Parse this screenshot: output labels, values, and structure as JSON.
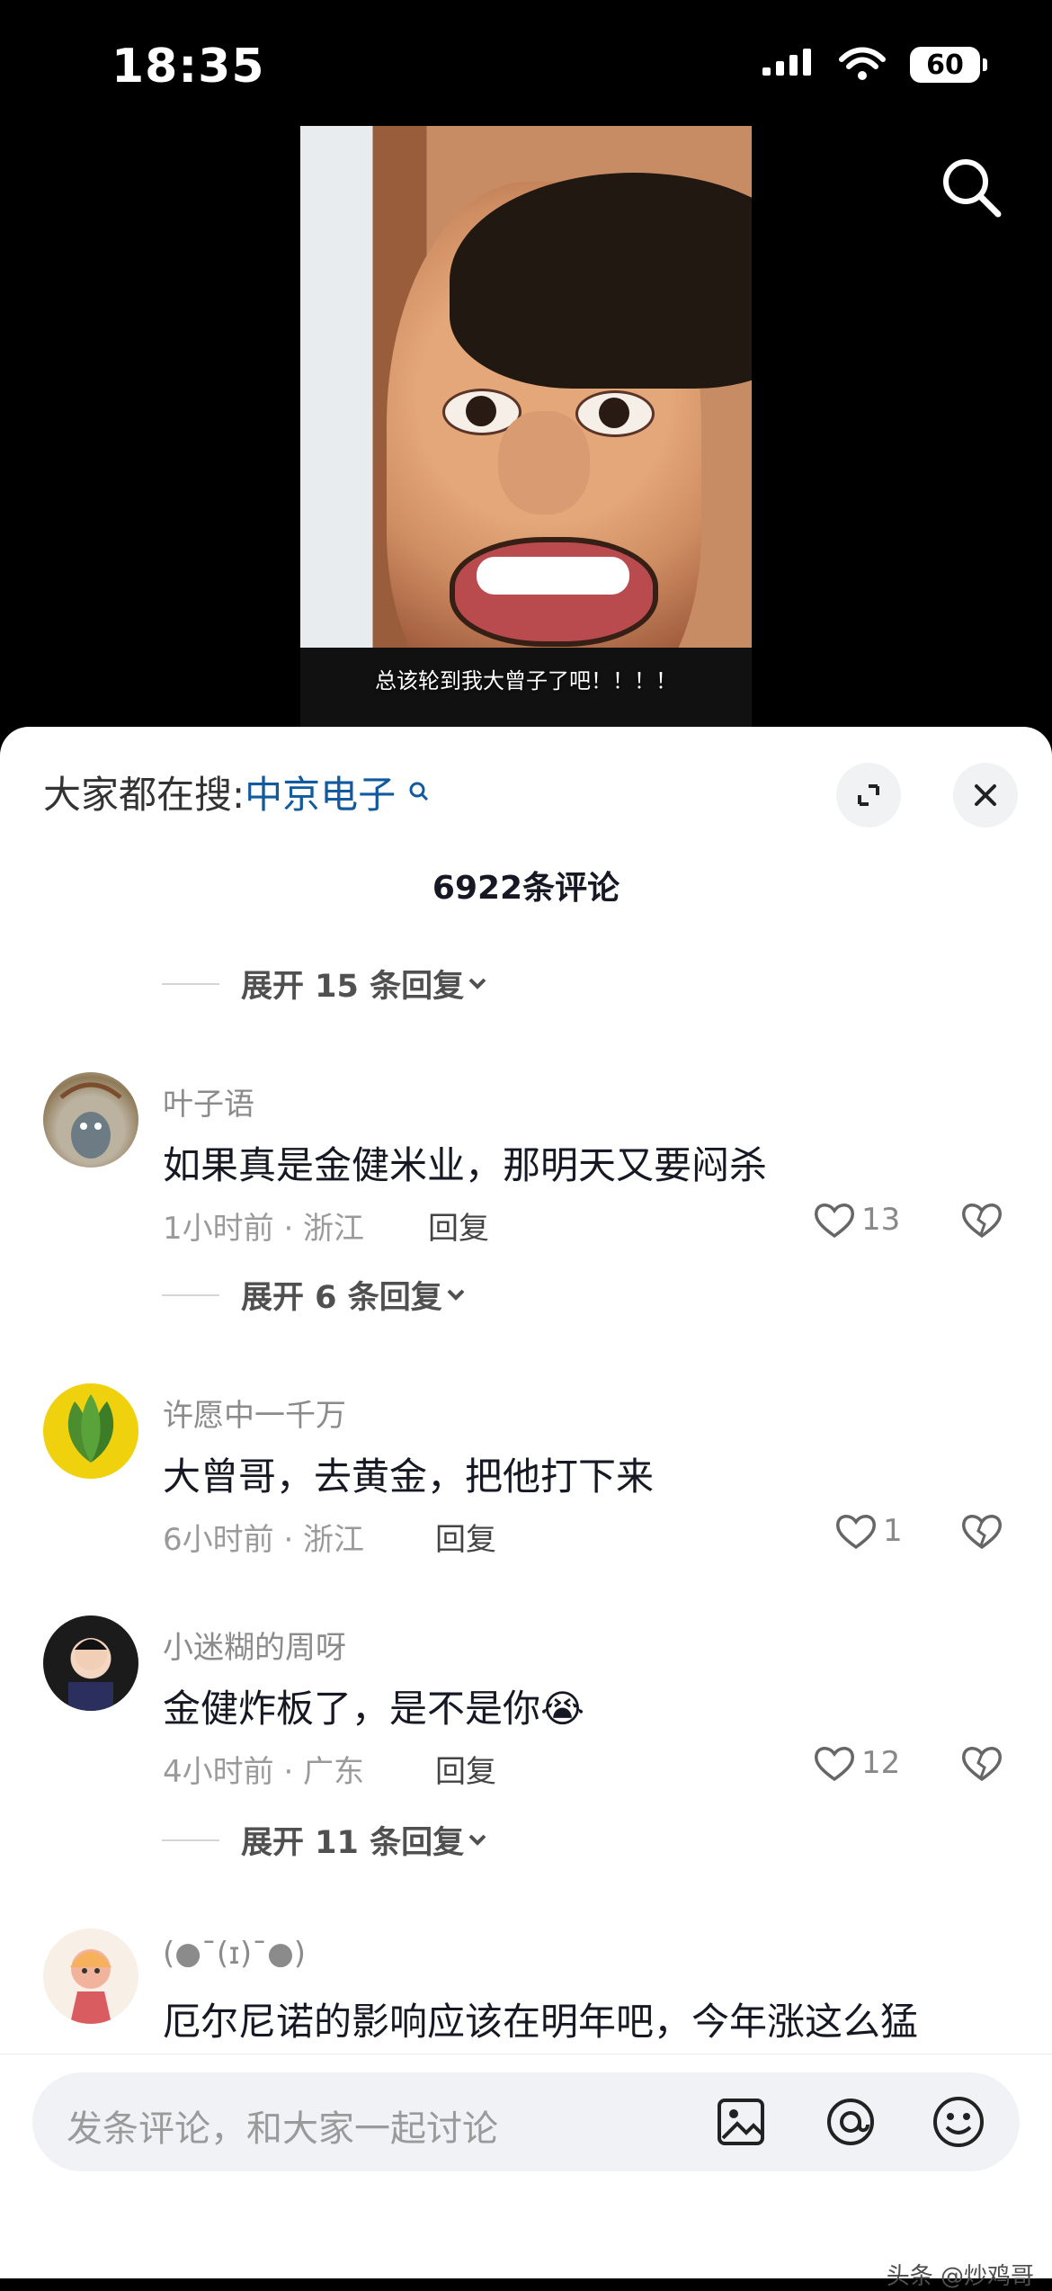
{
  "status_bar": {
    "time": "18:35",
    "battery": "60"
  },
  "video": {
    "caption": "总该轮到我大曾子了吧！！！！"
  },
  "sheet": {
    "search_label": "大家都在搜:",
    "search_term": "中京电子",
    "comment_count": "6922条评论",
    "expand_replies_top": "展开 15 条回复"
  },
  "comments": [
    {
      "name": "叶子语",
      "text": "如果真是金健米业，那明天又要闷杀",
      "meta": "1小时前 · 浙江",
      "reply": "回复",
      "likes": "13",
      "expand": "展开 6 条回复"
    },
    {
      "name": "许愿中一千万",
      "text": "大曾哥，去黄金，把他打下来",
      "meta": "6小时前 · 浙江",
      "reply": "回复",
      "likes": "1"
    },
    {
      "name": "小迷糊的周呀",
      "text": "金健炸板了，是不是你😭",
      "meta": "4小时前 · 广东",
      "reply": "回复",
      "likes": "12",
      "expand": "展开 11 条回复"
    },
    {
      "name": "(●ˉ(ɪ)ˉ●)",
      "text": "厄尔尼诺的影响应该在明年吧，今年涨这么猛"
    }
  ],
  "input": {
    "placeholder": "发条评论，和大家一起讨论"
  },
  "watermark": "头条 @炒鸡哥",
  "icons": [
    "search-icon",
    "expand-icon",
    "close-icon",
    "heart-icon",
    "broken-heart-icon",
    "image-icon",
    "at-icon",
    "emoji-icon"
  ]
}
